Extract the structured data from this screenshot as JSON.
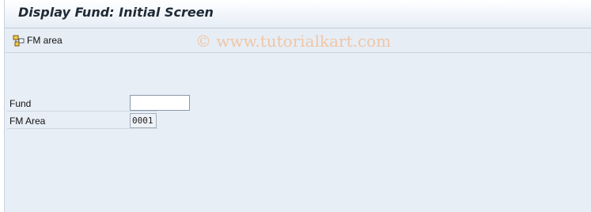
{
  "window": {
    "title": "Display Fund: Initial Screen"
  },
  "toolbar": {
    "fm_area_button_label": "FM area",
    "fm_area_icon": "hierarchy-icon"
  },
  "watermark": {
    "text": "© www.tutorialkart.com"
  },
  "form": {
    "fund": {
      "label": "Fund",
      "value": ""
    },
    "fm_area": {
      "label": "FM Area",
      "value": "0001"
    }
  },
  "colors": {
    "background": "#e8eef6",
    "title_text": "#1f2a36",
    "watermark": "#f0c6a6"
  }
}
